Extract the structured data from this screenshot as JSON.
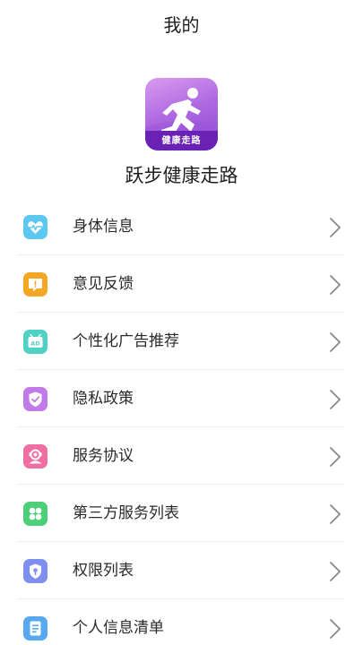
{
  "header": {
    "title": "我的"
  },
  "app": {
    "logo_text": "健康走路",
    "name": "跃步健康走路"
  },
  "colors": {
    "chevron": "#888888",
    "divider": "#ececec",
    "logo_band": "#6a22b6"
  },
  "menu": {
    "items": [
      {
        "label": "身体信息",
        "icon": "heartbeat-icon",
        "color": "#5cc8f2"
      },
      {
        "label": "意见反馈",
        "icon": "feedback-icon",
        "color": "#f4a723"
      },
      {
        "label": "个性化广告推荐",
        "icon": "ad-icon",
        "color": "#4fd1c5"
      },
      {
        "label": "隐私政策",
        "icon": "privacy-shield-icon",
        "color": "#c07be8"
      },
      {
        "label": "服务协议",
        "icon": "agreement-icon",
        "color": "#f06fa3"
      },
      {
        "label": "第三方服务列表",
        "icon": "third-party-icon",
        "color": "#4ccf79"
      },
      {
        "label": "权限列表",
        "icon": "permission-icon",
        "color": "#7f8ff0"
      },
      {
        "label": "个人信息清单",
        "icon": "info-list-icon",
        "color": "#58a8f0"
      }
    ]
  }
}
